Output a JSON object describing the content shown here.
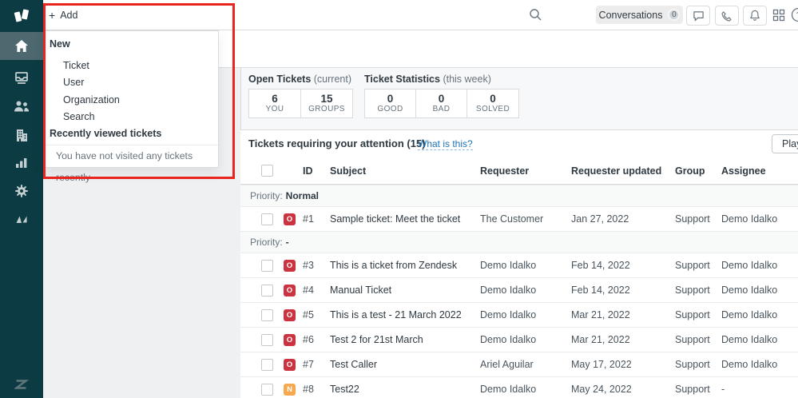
{
  "colors": {
    "sidebar_bg": "#0c3b43",
    "sidebar_active": "#4d686f",
    "annotation_red": "#e8251f",
    "link": "#1f73b7",
    "badges": {
      "O": "#cb3340",
      "N": "#f5a84e"
    }
  },
  "topbar": {
    "add_plus": "+",
    "add_label": "Add",
    "conversations_label": "Conversations",
    "conversations_count": "0"
  },
  "add_menu": {
    "section_new": "New",
    "items": [
      {
        "label": "Ticket"
      },
      {
        "label": "User"
      },
      {
        "label": "Organization"
      },
      {
        "label": "Search"
      }
    ],
    "section_recent": "Recently viewed tickets",
    "empty_message": "You have not visited any tickets recently"
  },
  "stats": {
    "open": {
      "title": "Open Tickets",
      "subtitle": "(current)",
      "cells": [
        {
          "value": "6",
          "label": "YOU"
        },
        {
          "value": "15",
          "label": "GROUPS"
        }
      ]
    },
    "week": {
      "title": "Ticket Statistics",
      "subtitle": "(this week)",
      "cells": [
        {
          "value": "0",
          "label": "GOOD"
        },
        {
          "value": "0",
          "label": "BAD"
        },
        {
          "value": "0",
          "label": "SOLVED"
        }
      ]
    }
  },
  "attention": {
    "title": "Tickets requiring your attention (15)",
    "link": "What is this?",
    "play_label": "Play"
  },
  "table": {
    "columns": [
      "ID",
      "Subject",
      "Requester",
      "Requester updated",
      "Group",
      "Assignee"
    ],
    "groups": [
      {
        "prefix": "Priority:",
        "value": "Normal",
        "rows": [
          {
            "status": "O",
            "id": "#1",
            "subject": "Sample ticket: Meet the ticket",
            "requester": "The Customer",
            "updated": "Jan 27, 2022",
            "group": "Support",
            "assignee": "Demo Idalko"
          }
        ]
      },
      {
        "prefix": "Priority:",
        "value": "-",
        "rows": [
          {
            "status": "O",
            "id": "#3",
            "subject": "This is a ticket from Zendesk",
            "requester": "Demo Idalko",
            "updated": "Feb 14, 2022",
            "group": "Support",
            "assignee": "Demo Idalko"
          },
          {
            "status": "O",
            "id": "#4",
            "subject": "Manual Ticket",
            "requester": "Demo Idalko",
            "updated": "Feb 14, 2022",
            "group": "Support",
            "assignee": "Demo Idalko"
          },
          {
            "status": "O",
            "id": "#5",
            "subject": "This is a test - 21 March 2022",
            "requester": "Demo Idalko",
            "updated": "Mar 21, 2022",
            "group": "Support",
            "assignee": "Demo Idalko"
          },
          {
            "status": "O",
            "id": "#6",
            "subject": "Test 2 for 21st March",
            "requester": "Demo Idalko",
            "updated": "Mar 21, 2022",
            "group": "Support",
            "assignee": "Demo Idalko"
          },
          {
            "status": "O",
            "id": "#7",
            "subject": "Test Caller",
            "requester": "Ariel Aguilar",
            "updated": "May 17, 2022",
            "group": "Support",
            "assignee": "Demo Idalko"
          },
          {
            "status": "N",
            "id": "#8",
            "subject": "Test22",
            "requester": "Demo Idalko",
            "updated": "May 24, 2022",
            "group": "Support",
            "assignee": "-"
          }
        ]
      }
    ]
  }
}
